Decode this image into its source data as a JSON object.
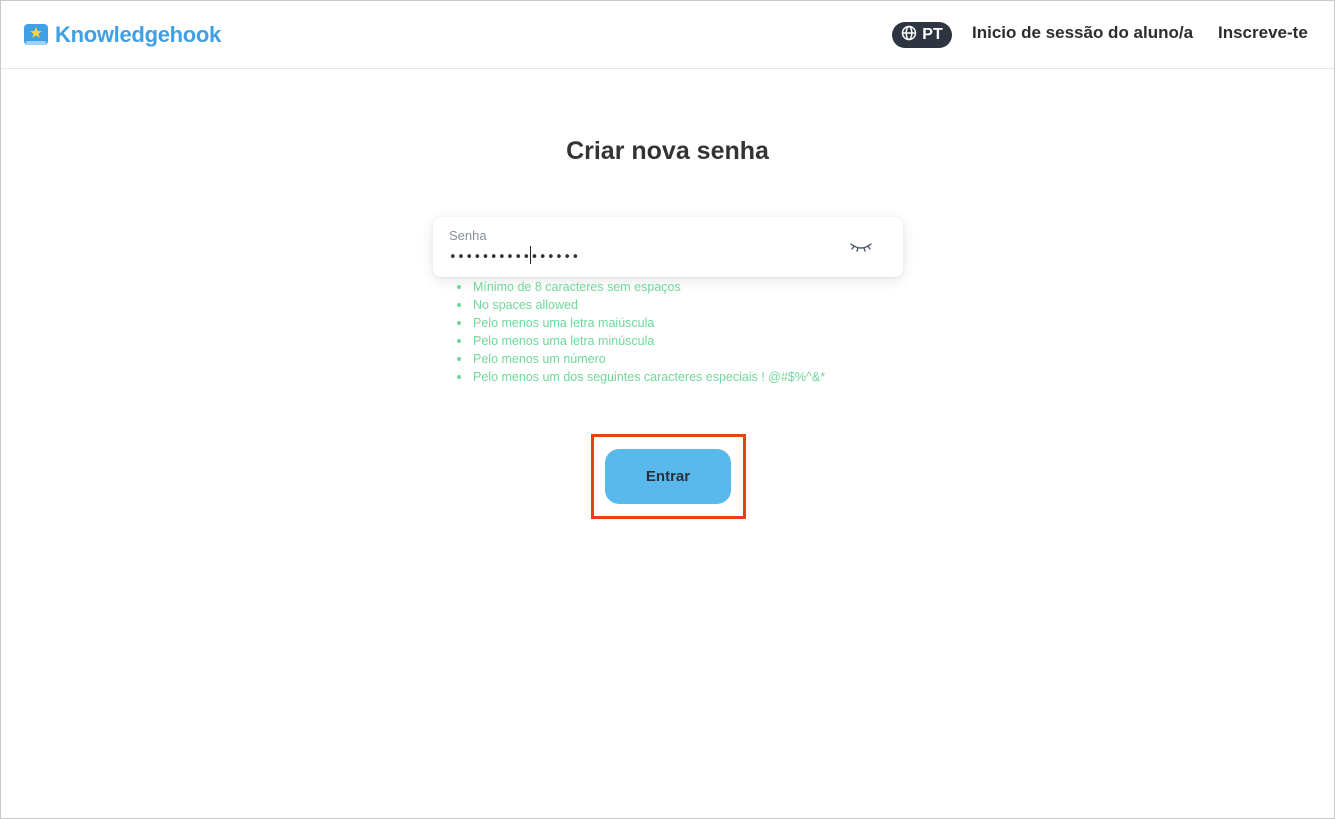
{
  "header": {
    "logo_text": "Knowledgehook",
    "language": "PT",
    "nav_login": "Inicio de sessão do aluno/a",
    "nav_signup": "Inscreve-te"
  },
  "main": {
    "title": "Criar nova senha",
    "password_field": {
      "label": "Senha",
      "value": "••••••••••••••••",
      "masked": true
    },
    "rules": [
      "Mínimo de 8 caracteres sem espaços",
      "No spaces allowed",
      "Pelo menos uma letra maiúscula",
      "Pelo menos uma letra minúscula",
      "Pelo menos um número",
      "Pelo menos um dos seguintes caracteres especiais ! @#$%^&*"
    ],
    "submit_label": "Entrar"
  },
  "colors": {
    "brand": "#3fa0e3",
    "button": "#5ab9ec",
    "rule_ok": "#6fd89a",
    "highlight": "#e8401c",
    "lang_pill": "#2e3440"
  },
  "icons": {
    "logo": "book-star-icon",
    "language": "globe-icon",
    "toggle_visibility": "eye-closed-icon"
  }
}
